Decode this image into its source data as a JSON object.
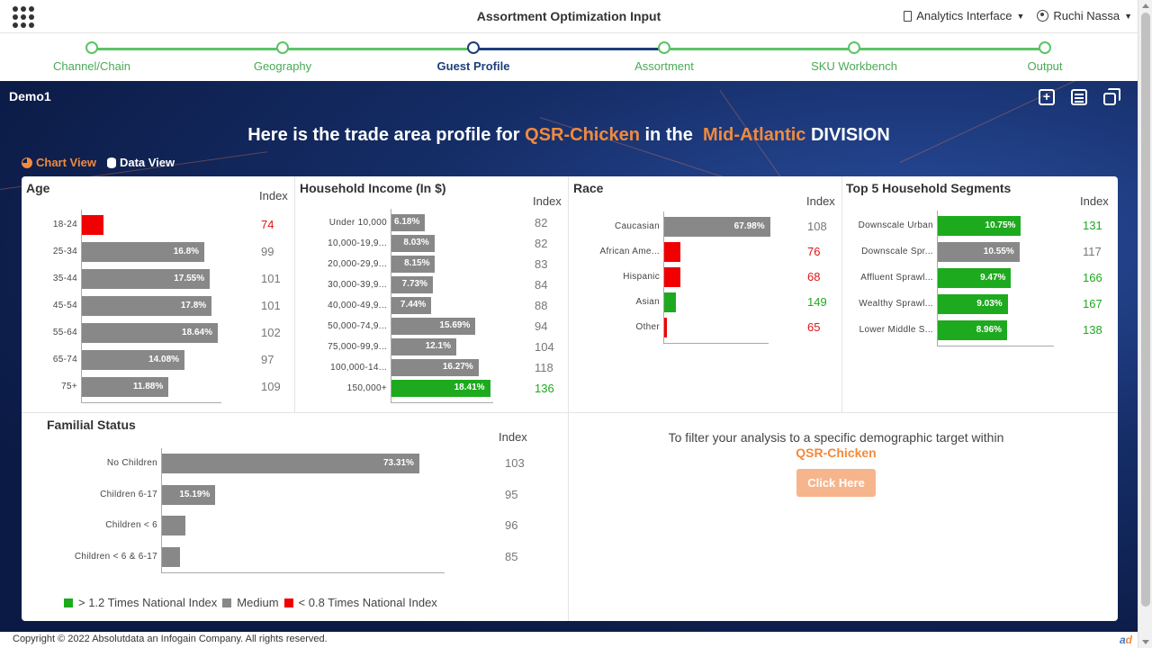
{
  "header": {
    "title": "Assortment Optimization Input",
    "interface_menu": "Analytics Interface",
    "user_menu": "Ruchi Nassa"
  },
  "stepper": {
    "steps": [
      {
        "label": "Channel/Chain",
        "active": false
      },
      {
        "label": "Geography",
        "active": false
      },
      {
        "label": "Guest Profile",
        "active": true
      },
      {
        "label": "Assortment",
        "active": false
      },
      {
        "label": "SKU Workbench",
        "active": false
      },
      {
        "label": "Output",
        "active": false
      }
    ]
  },
  "hero": {
    "demo_label": "Demo1",
    "headline_prefix": "Here is the trade area profile for",
    "category": "QSR-Chicken",
    "headline_mid": "in the",
    "division": "Mid-Atlantic",
    "headline_suffix": "DIVISION",
    "chart_view_label": "Chart View",
    "data_view_label": "Data View"
  },
  "index_label": "Index",
  "colors": {
    "green": "#1eaa1e",
    "grey": "#888888",
    "red": "#f00000",
    "accent": "#f28a3c"
  },
  "chart_data": [
    {
      "type": "bar",
      "title": "Age",
      "categories": [
        "18-24",
        "25-34",
        "35-44",
        "45-54",
        "55-64",
        "65-74",
        "75+"
      ],
      "values": [
        null,
        16.8,
        17.55,
        17.8,
        18.64,
        14.08,
        11.88
      ],
      "value_labels": [
        "",
        "16.8%",
        "17.55%",
        "17.8%",
        "18.64%",
        "14.08%",
        "11.88%"
      ],
      "index": [
        74,
        99,
        101,
        101,
        102,
        97,
        109
      ],
      "status": [
        "low",
        "medium",
        "medium",
        "medium",
        "medium",
        "medium",
        "medium"
      ]
    },
    {
      "type": "bar",
      "title": "Household Income (In $)",
      "categories": [
        "Under 10,000",
        "10,000-19,9...",
        "20,000-29,9...",
        "30,000-39,9...",
        "40,000-49,9...",
        "50,000-74,9...",
        "75,000-99,9...",
        "100,000-14...",
        "150,000+"
      ],
      "values": [
        6.18,
        8.03,
        8.15,
        7.73,
        7.44,
        15.69,
        12.1,
        16.27,
        18.41
      ],
      "value_labels": [
        "6.18%",
        "8.03%",
        "8.15%",
        "7.73%",
        "7.44%",
        "15.69%",
        "12.1%",
        "16.27%",
        "18.41%"
      ],
      "index": [
        82,
        82,
        83,
        84,
        88,
        94,
        104,
        118,
        136
      ],
      "status": [
        "medium",
        "medium",
        "medium",
        "medium",
        "medium",
        "medium",
        "medium",
        "medium",
        "high"
      ]
    },
    {
      "type": "bar",
      "title": "Race",
      "categories": [
        "Caucasian",
        "African Ame...",
        "Hispanic",
        "Asian",
        "Other"
      ],
      "values": [
        67.98,
        null,
        null,
        null,
        null
      ],
      "value_labels": [
        "67.98%",
        "",
        "",
        "",
        ""
      ],
      "index": [
        108,
        76,
        68,
        149,
        65
      ],
      "status": [
        "medium",
        "low",
        "low",
        "high",
        "low"
      ]
    },
    {
      "type": "bar",
      "title": "Top 5 Household Segments",
      "categories": [
        "Downscale Urban",
        "Downscale Spr...",
        "Affluent Sprawl...",
        "Wealthy Sprawl...",
        "Lower Middle S..."
      ],
      "values": [
        10.75,
        10.55,
        9.47,
        9.03,
        8.96
      ],
      "value_labels": [
        "10.75%",
        "10.55%",
        "9.47%",
        "9.03%",
        "8.96%"
      ],
      "index": [
        131,
        117,
        166,
        167,
        138
      ],
      "status": [
        "high",
        "medium",
        "high",
        "high",
        "high"
      ]
    },
    {
      "type": "bar",
      "title": "Familial Status",
      "categories": [
        "No Children",
        "Children 6-17",
        "Children < 6",
        "Children < 6 & 6-17"
      ],
      "values": [
        73.31,
        15.19,
        null,
        null
      ],
      "value_labels": [
        "73.31%",
        "15.19%",
        "",
        ""
      ],
      "index": [
        103,
        95,
        96,
        85
      ],
      "status": [
        "medium",
        "medium",
        "medium",
        "medium"
      ]
    }
  ],
  "legend": {
    "high": "> 1.2 Times National Index",
    "medium": "Medium",
    "low": "< 0.8 Times National Index"
  },
  "filter": {
    "text": "To filter your analysis to a specific demographic target within",
    "category": "QSR-Chicken",
    "button": "Click Here"
  },
  "footer": {
    "copyright": "Copyright © 2022 Absolutdata an Infogain Company. All rights reserved.",
    "logo": "ad"
  }
}
